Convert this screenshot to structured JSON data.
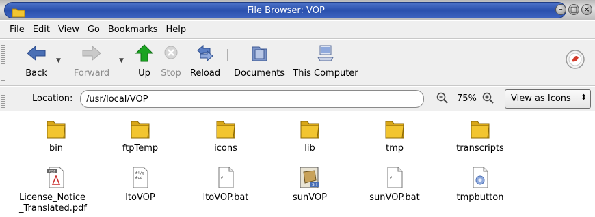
{
  "window": {
    "title": "File Browser: VOP",
    "controls": [
      "minimize",
      "maximize",
      "close"
    ]
  },
  "menu": [
    {
      "first": "F",
      "rest": "ile"
    },
    {
      "first": "E",
      "rest": "dit"
    },
    {
      "first": "V",
      "rest": "iew"
    },
    {
      "first": "G",
      "rest": "o"
    },
    {
      "first": "B",
      "rest": "ookmarks"
    },
    {
      "first": "H",
      "rest": "elp"
    }
  ],
  "toolbar": {
    "back": "Back",
    "forward": "Forward",
    "up": "Up",
    "stop": "Stop",
    "reload": "Reload",
    "documents": "Documents",
    "this_computer": "This Computer"
  },
  "location": {
    "label": "Location:",
    "value": "/usr/local/VOP"
  },
  "zoom": {
    "level": "75%"
  },
  "view_mode": {
    "selected": "View as Icons"
  },
  "files": [
    {
      "name": "bin",
      "icon": "folder-icon"
    },
    {
      "name": "ftpTemp",
      "icon": "folder-icon"
    },
    {
      "name": "icons",
      "icon": "folder-icon"
    },
    {
      "name": "lib",
      "icon": "folder-icon"
    },
    {
      "name": "tmp",
      "icon": "folder-icon"
    },
    {
      "name": "transcripts",
      "icon": "folder-icon"
    },
    {
      "name": "License_Notice\n_Translated.pdf",
      "icon": "pdf-file-icon"
    },
    {
      "name": "ltoVOP",
      "icon": "script-file-icon"
    },
    {
      "name": "ltoVOP.bat",
      "icon": "text-file-icon"
    },
    {
      "name": "sunVOP",
      "icon": "shell-script-icon"
    },
    {
      "name": "sunVOP.bat",
      "icon": "text-file-icon"
    },
    {
      "name": "tmpbutton",
      "icon": "image-file-icon"
    }
  ],
  "colors": {
    "title_bar": "#2a50ad",
    "folder": "#f2c530",
    "up_arrow": "#1aa321",
    "back_arrow": "#4a6fb5"
  }
}
